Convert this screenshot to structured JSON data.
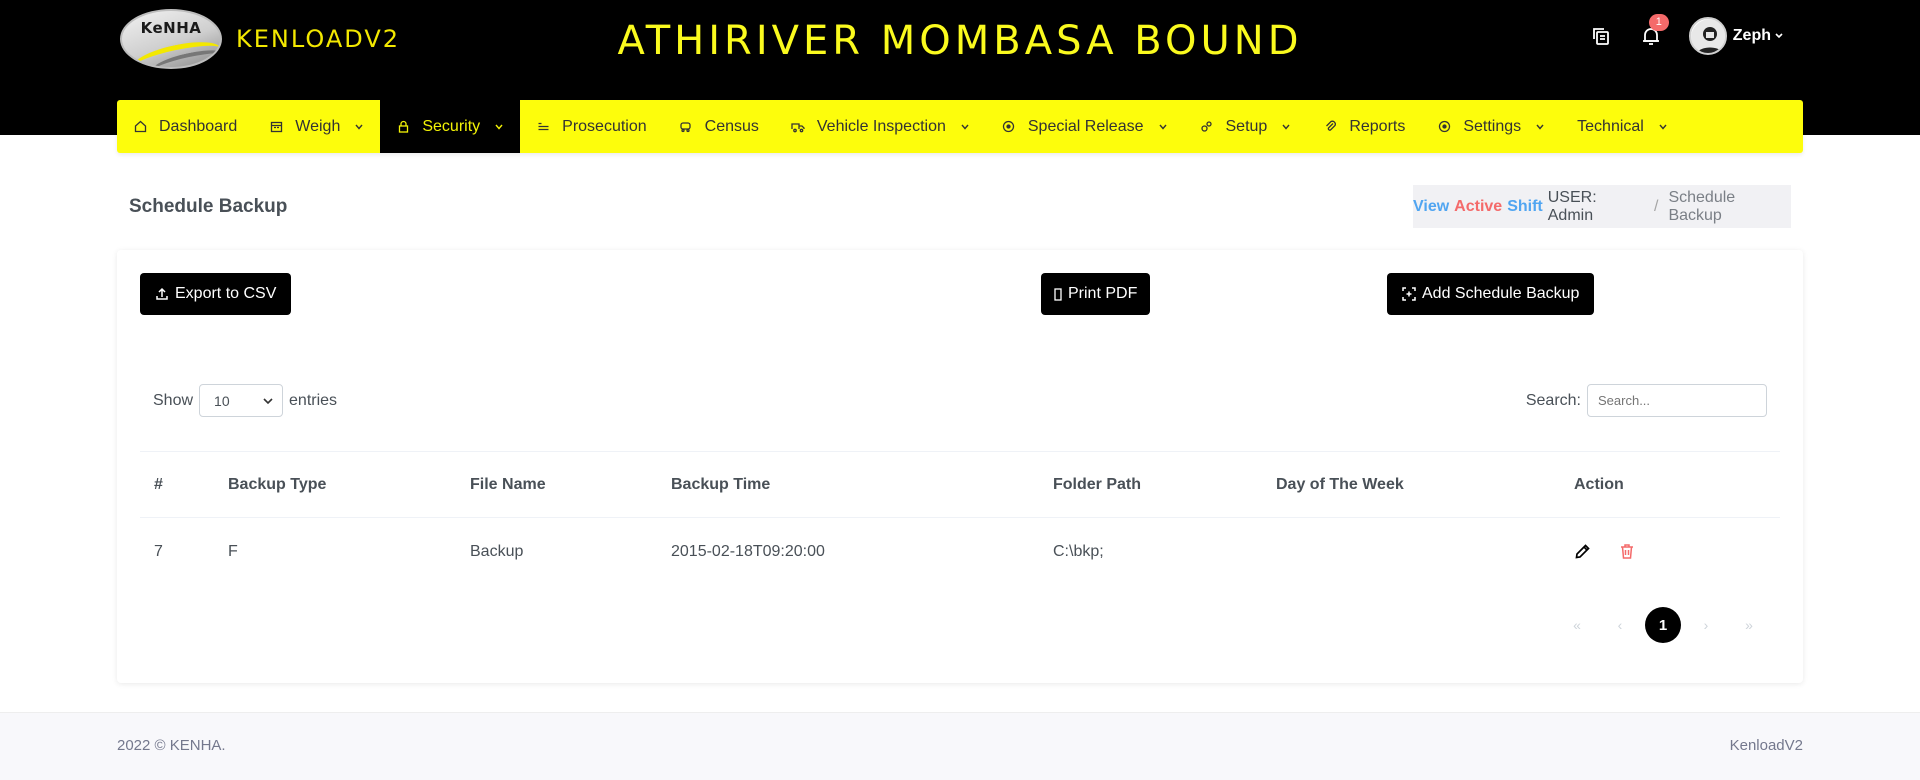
{
  "brand": {
    "logo_text": "KeNHA",
    "name": "KENLOADV2"
  },
  "header": {
    "title": "ATHIRIVER MOMBASA BOUND",
    "notification_count": "1",
    "user_name": "Zeph"
  },
  "nav": {
    "items": [
      {
        "label": "Dashboard",
        "icon": "home-icon"
      },
      {
        "label": "Weigh",
        "icon": "calendar-icon",
        "dropdown": true
      },
      {
        "label": "Security",
        "icon": "lock-icon",
        "dropdown": true,
        "active": true
      },
      {
        "label": "Prosecution",
        "icon": "list-icon"
      },
      {
        "label": "Census",
        "icon": "car-icon"
      },
      {
        "label": "Vehicle Inspection",
        "icon": "truck-icon",
        "dropdown": true
      },
      {
        "label": "Special Release",
        "icon": "circle-dot-icon",
        "dropdown": true
      },
      {
        "label": "Setup",
        "icon": "gears-icon",
        "dropdown": true
      },
      {
        "label": "Reports",
        "icon": "paperclip-icon"
      },
      {
        "label": "Settings",
        "icon": "circle-dot-icon",
        "dropdown": true
      },
      {
        "label": "Technical",
        "icon": "",
        "dropdown": true
      }
    ]
  },
  "page": {
    "title": "Schedule Backup"
  },
  "breadcrumb": {
    "view": "View",
    "active": "Active",
    "shift": "Shift",
    "user": "USER: Admin",
    "separator": "/",
    "current": "Schedule Backup"
  },
  "actions": {
    "export_csv": "Export to CSV",
    "print_pdf": "Print PDF",
    "add": "Add Schedule Backup"
  },
  "table_controls": {
    "show": "Show",
    "entries_value": "10",
    "entries": "entries",
    "search_label": "Search:",
    "search_placeholder": "Search..."
  },
  "table": {
    "columns": [
      "#",
      "Backup Type",
      "File Name",
      "Backup Time",
      "Folder Path",
      "Day of The Week",
      "Action"
    ],
    "rows": [
      {
        "id": "7",
        "type": "F",
        "file": "Backup",
        "time": "2015-02-18T09:20:00",
        "path": "C:\\bkp;",
        "day": ""
      }
    ]
  },
  "pagination": {
    "first": "«",
    "prev": "‹",
    "current": "1",
    "next": "›",
    "last": "»"
  },
  "footer": {
    "left": "2022 © KENHA.",
    "right": "KenloadV2"
  },
  "colors": {
    "accent_yellow": "#fdfd0c",
    "heading_yellow": "#fafa1e",
    "danger": "#f46a6a",
    "info": "#50a5f1"
  }
}
